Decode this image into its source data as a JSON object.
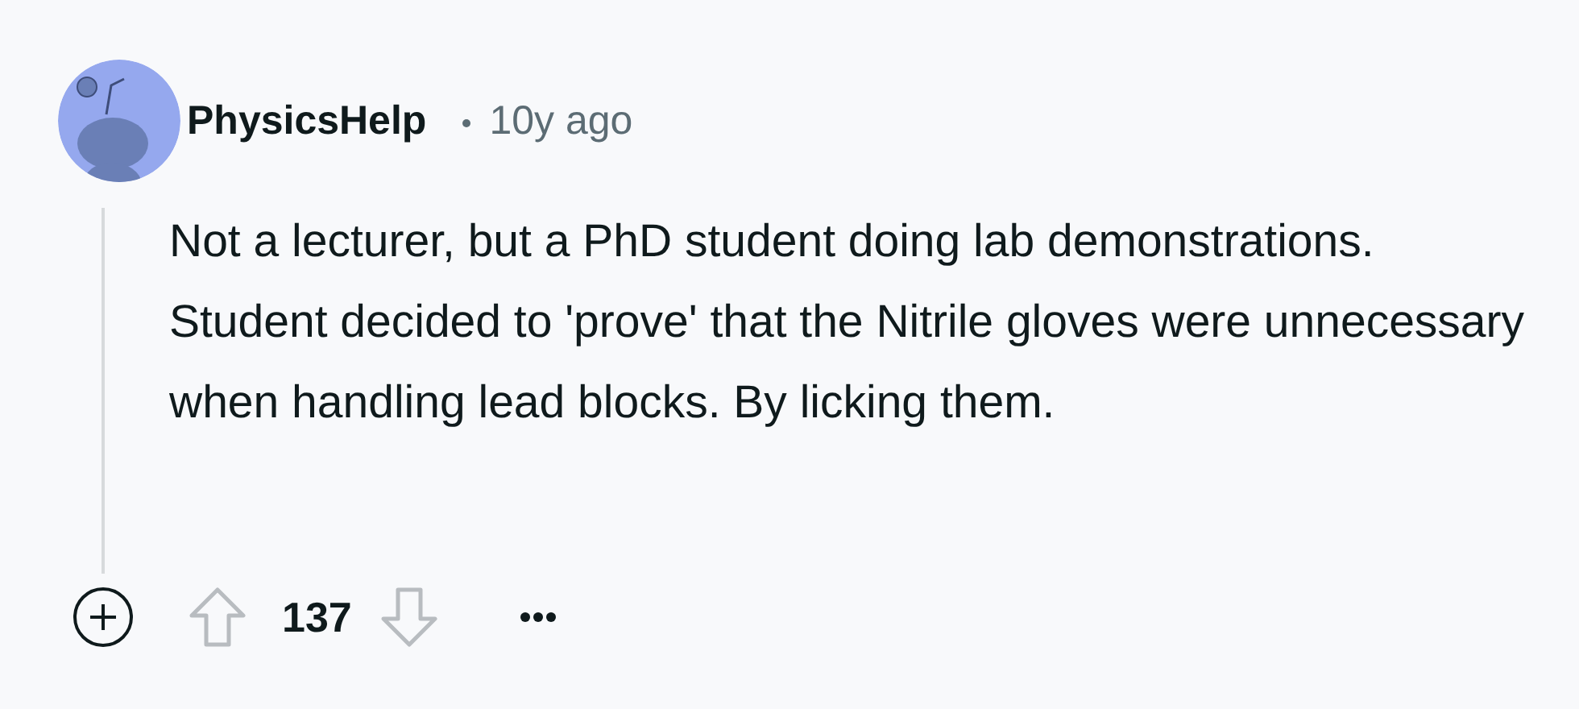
{
  "comment": {
    "author": "PhysicsHelp",
    "age": "10y ago",
    "body": "Not a lecturer, but a PhD student doing lab demonstrations. Student decided to 'prove' that the Nitrile gloves were unnecessary when handling lead blocks. By licking them.",
    "score": "137"
  }
}
